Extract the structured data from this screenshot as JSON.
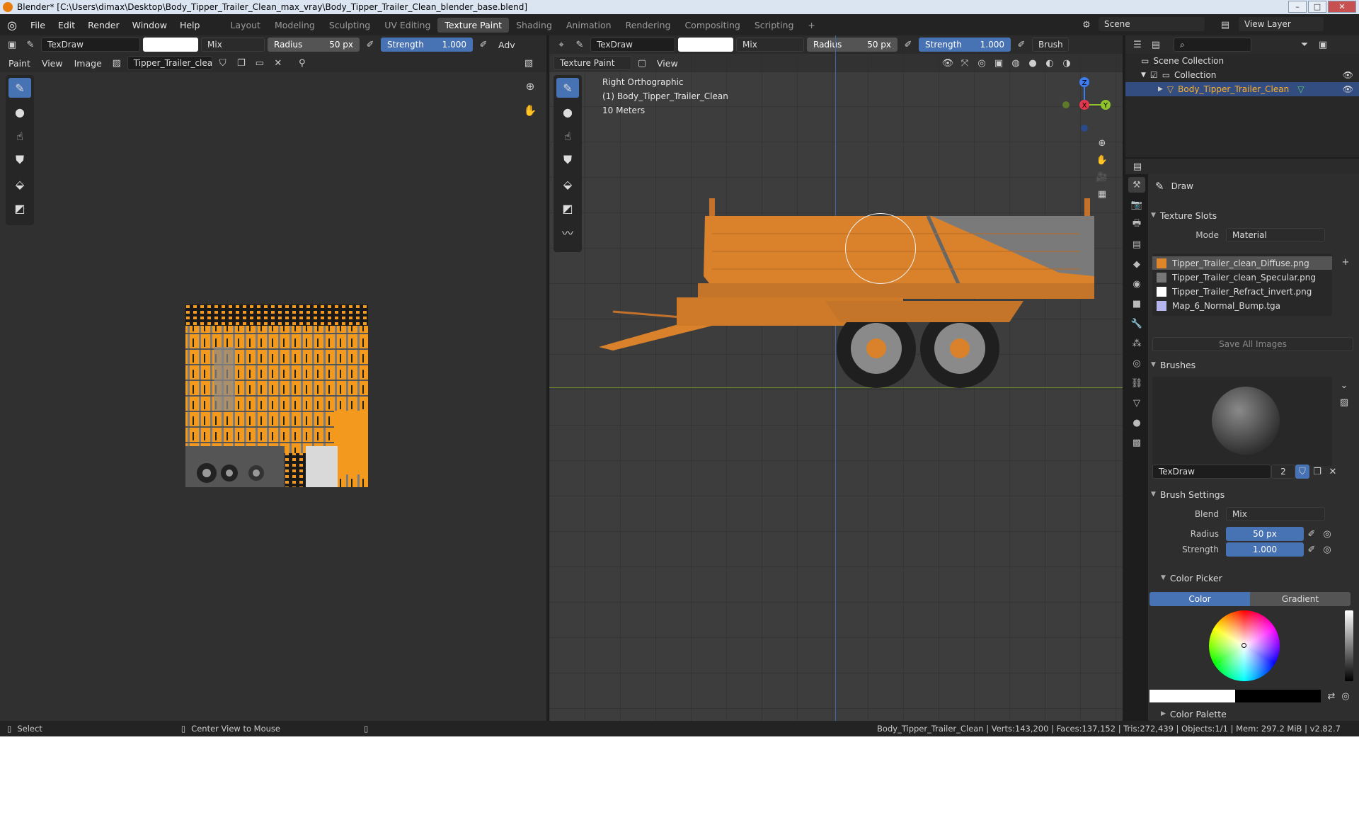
{
  "window": {
    "title": "Blender* [C:\\Users\\dimax\\Desktop\\Body_Tipper_Trailer_Clean_max_vray\\Body_Tipper_Trailer_Clean_blender_base.blend]",
    "minimize": "–",
    "maximize": "□",
    "close": "✕"
  },
  "menu": {
    "items": [
      "File",
      "Edit",
      "Render",
      "Window",
      "Help"
    ],
    "workspaces": [
      "Layout",
      "Modeling",
      "Sculpting",
      "UV Editing",
      "Texture Paint",
      "Shading",
      "Animation",
      "Rendering",
      "Compositing",
      "Scripting"
    ],
    "active_workspace": "Texture Paint",
    "add": "+",
    "scene": "Scene",
    "view_layer": "View Layer"
  },
  "image_editor": {
    "header": {
      "brush": "TexDraw",
      "blend": "Mix",
      "radius_label": "Radius",
      "radius_value": "50 px",
      "strength_label": "Strength",
      "strength_value": "1.000",
      "more": "Adv"
    },
    "header2": {
      "mode": "Paint",
      "view": "View",
      "image": "Image",
      "image_name": "Tipper_Trailer_clean.."
    }
  },
  "viewport": {
    "header": {
      "brush": "TexDraw",
      "blend": "Mix",
      "radius_label": "Radius",
      "radius_value": "50 px",
      "strength_label": "Strength",
      "strength_value": "1.000",
      "brush_menu": "Brush"
    },
    "header2": {
      "mode": "Texture Paint",
      "view": "View"
    },
    "overlay": {
      "view_name": "Right Orthographic",
      "object": "(1) Body_Tipper_Trailer_Clean",
      "scale": "10 Meters"
    },
    "gizmo": {
      "z": "Z",
      "y": "Y",
      "x": "X"
    }
  },
  "outliner": {
    "scene_collection": "Scene Collection",
    "collection": "Collection",
    "object": "Body_Tipper_Trailer_Clean"
  },
  "properties": {
    "tool_name": "Draw",
    "texture_slots": {
      "title": "Texture Slots",
      "mode_label": "Mode",
      "mode_value": "Material",
      "slots": [
        {
          "name": "Tipper_Trailer_clean_Diffuse.png",
          "color": "#e0862a"
        },
        {
          "name": "Tipper_Trailer_clean_Specular.png",
          "color": "#777777"
        },
        {
          "name": "Tipper_Trailer_Refract_invert.png",
          "color": "#ffffff"
        },
        {
          "name": "Map_6_Normal_Bump.tga",
          "color": "#b7b5f0"
        }
      ],
      "save_all": "Save All Images"
    },
    "brushes": {
      "title": "Brushes",
      "name": "TexDraw",
      "users": "2"
    },
    "brush_settings": {
      "title": "Brush Settings",
      "blend_label": "Blend",
      "blend_value": "Mix",
      "radius_label": "Radius",
      "radius_value": "50 px",
      "strength_label": "Strength",
      "strength_value": "1.000"
    },
    "color_picker": {
      "title": "Color Picker",
      "tab_color": "Color",
      "tab_gradient": "Gradient"
    },
    "color_palette": {
      "title": "Color Palette"
    }
  },
  "status": {
    "select": "Select",
    "center": "Center View to Mouse",
    "stats": "Body_Tipper_Trailer_Clean | Verts:143,200 | Faces:137,152 | Tris:272,439 | Objects:1/1 | Mem: 297.2 MiB | v2.82.7"
  },
  "colors": {
    "accent": "#4772b3",
    "trailer": "#d9822b",
    "outline_active": "#ff8c1a"
  }
}
